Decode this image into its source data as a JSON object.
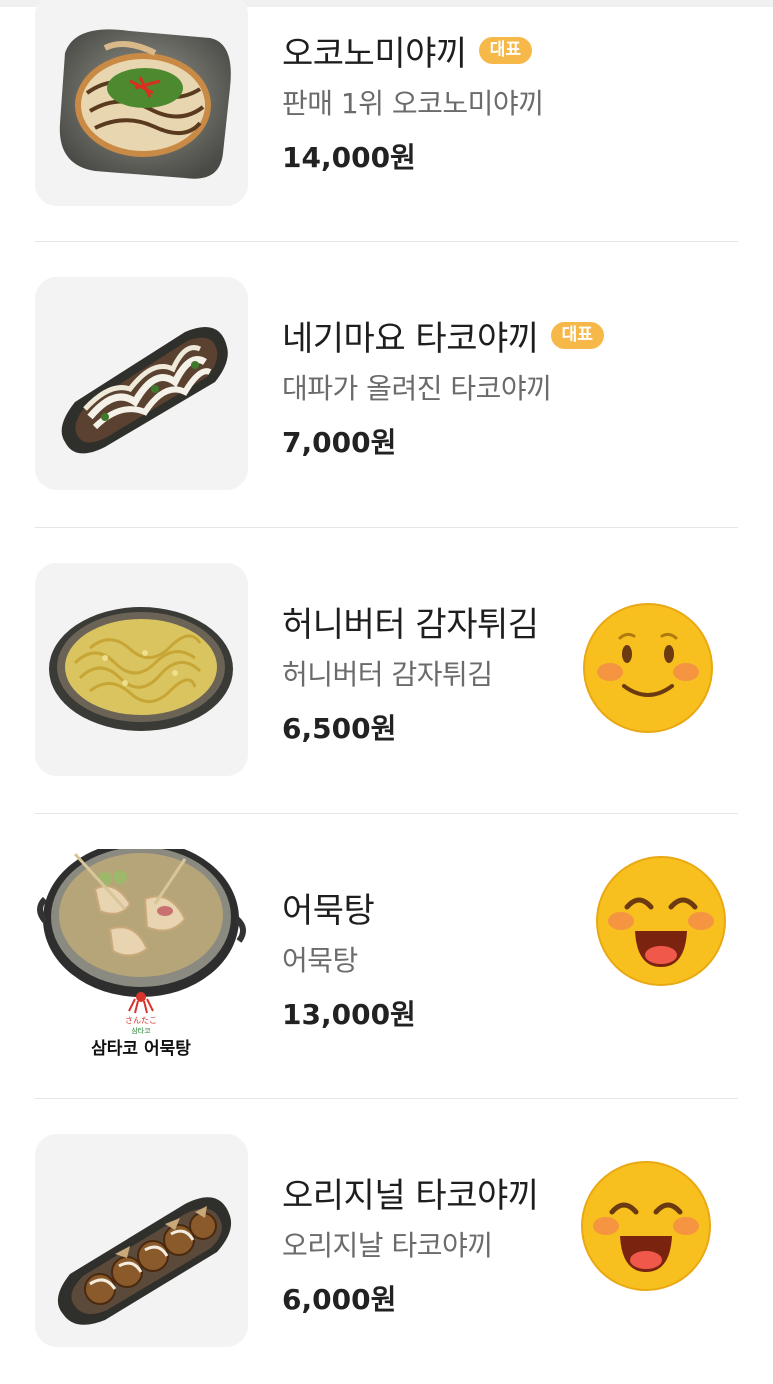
{
  "menu": {
    "items": [
      {
        "name": "오코노미야끼",
        "badge": "대표",
        "description": "판매 1위 오코노미야끼",
        "price": "14,000원",
        "image_icon": "okonomiyaki-photo",
        "emoji": null
      },
      {
        "name": "네기마요 타코야끼",
        "badge": "대표",
        "description": "대파가 올려진 타코야끼",
        "price": "7,000원",
        "image_icon": "negimayo-takoyaki-photo",
        "emoji": null
      },
      {
        "name": "허니버터 감자튀김",
        "badge": "",
        "description": "허니버터 감자튀김",
        "price": "6,500원",
        "image_icon": "honey-butter-fries-photo",
        "emoji": "smiling-face-icon"
      },
      {
        "name": "어묵탕",
        "badge": "",
        "description": "어묵탕",
        "price": "13,000원",
        "image_icon": "fish-cake-soup-photo",
        "image_caption_small": "さんたこ",
        "image_caption_mid": "삼타코",
        "image_caption": "삼타코 어묵탕",
        "emoji": "grinning-face-icon"
      },
      {
        "name": "오리지널 타코야끼",
        "badge": "",
        "description": "오리지날 타코야끼",
        "price": "6,000원",
        "image_icon": "original-takoyaki-photo",
        "emoji": "grinning-face-icon"
      }
    ]
  },
  "colors": {
    "badge": "#f7b84a",
    "emoji_face": "#f7c01e",
    "divider": "#e6e6e6"
  }
}
